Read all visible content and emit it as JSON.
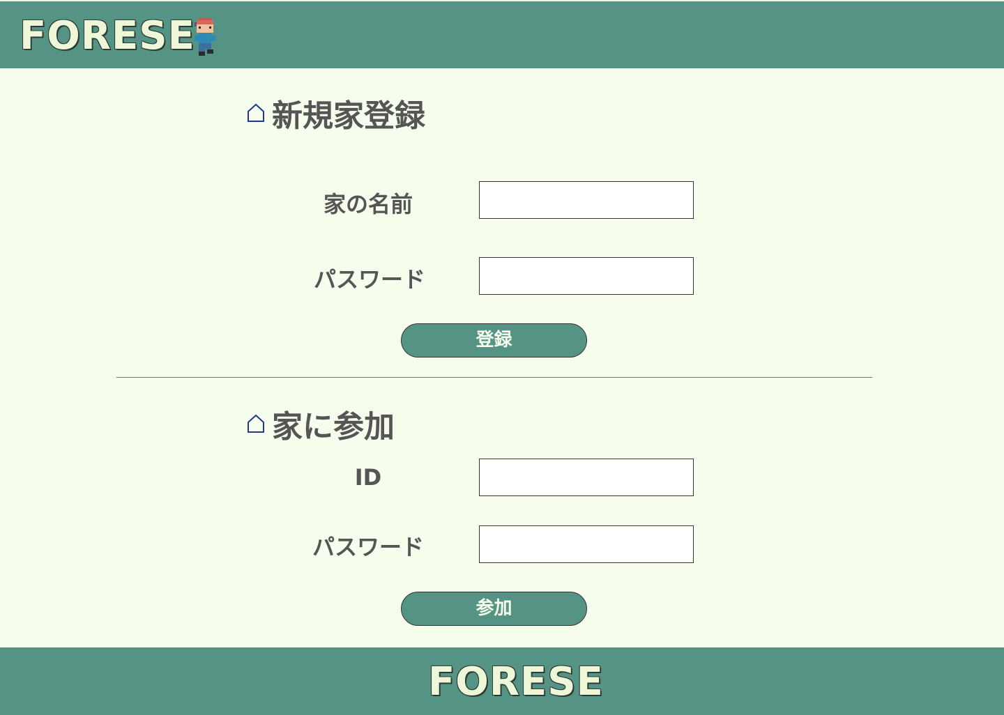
{
  "header": {
    "logo_text": "FORESE"
  },
  "register": {
    "title": "新規家登録",
    "house_name_label": "家の名前",
    "house_name_value": "",
    "password_label": "パスワード",
    "password_value": "",
    "button_label": "登録"
  },
  "join": {
    "title": "家に参加",
    "id_label": "ID",
    "id_value": "",
    "password_label": "パスワード",
    "password_value": "",
    "button_label": "参加"
  },
  "footer": {
    "logo_text": "FORESE"
  },
  "colors": {
    "brand": "#559385",
    "background": "#f6fdec",
    "text": "#555555",
    "icon": "#1f3a8a"
  },
  "icons": {
    "section": "home-outline-icon",
    "mascot": "pixel-character-icon"
  }
}
